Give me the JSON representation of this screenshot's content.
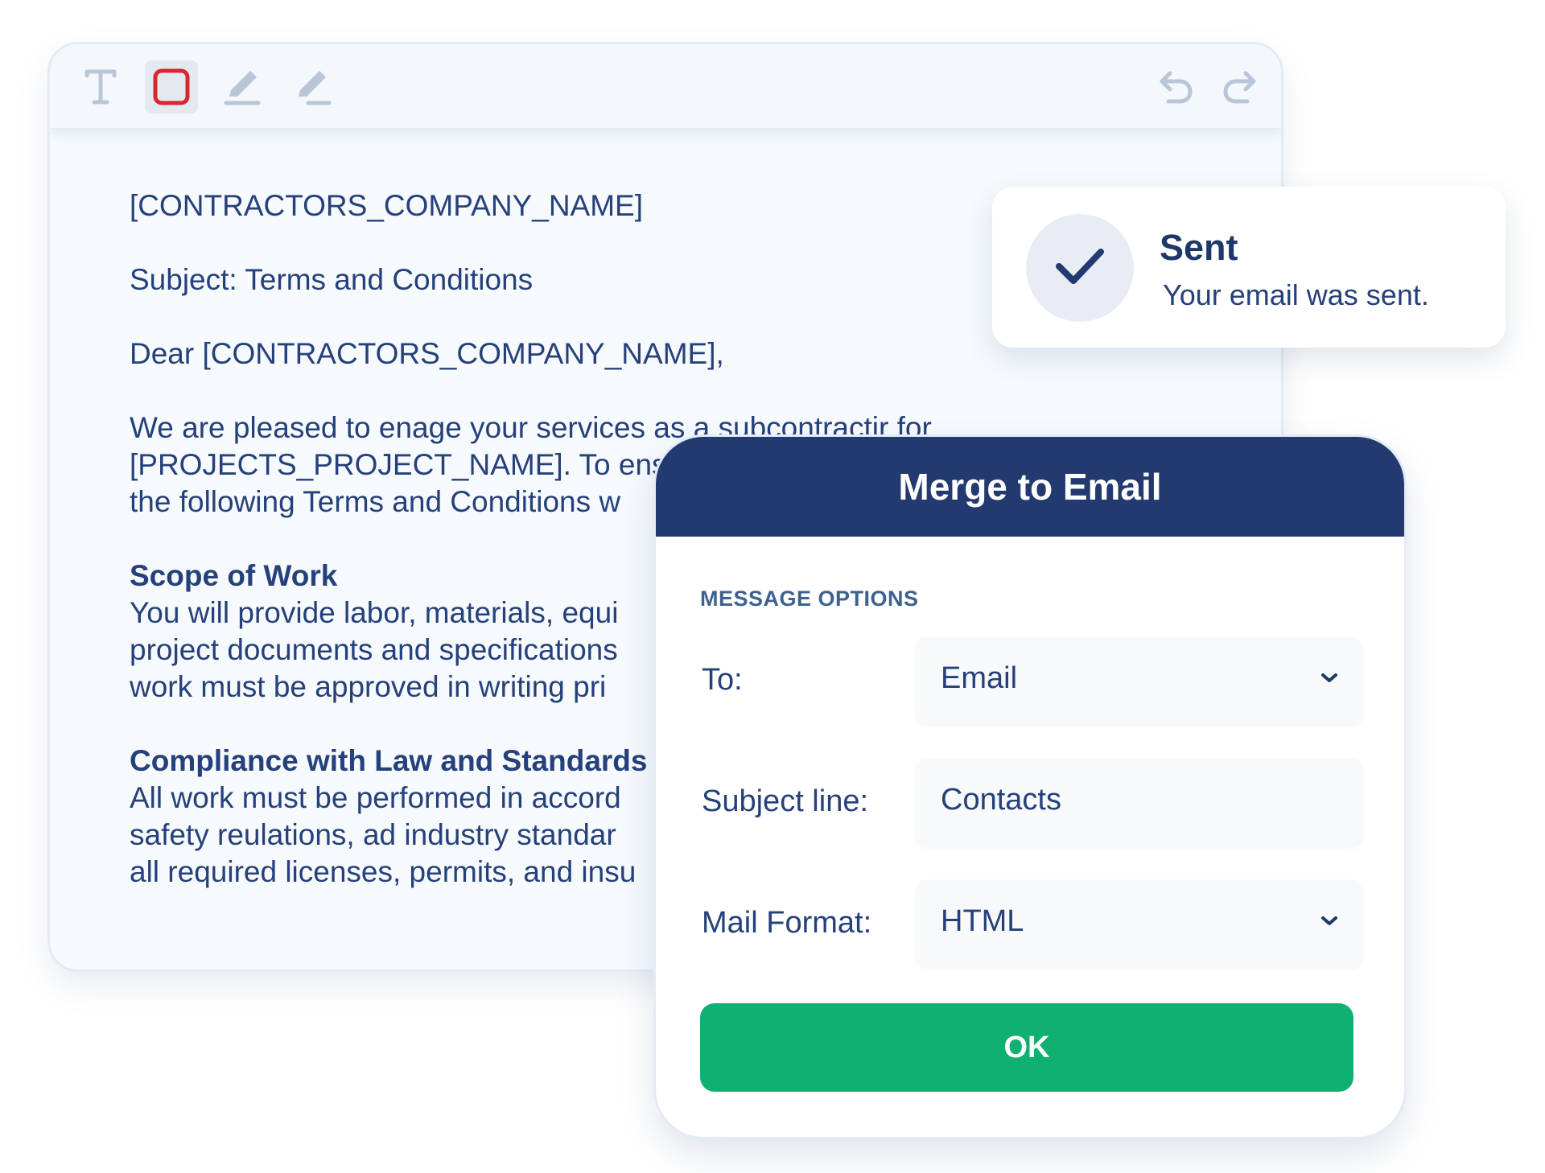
{
  "editor": {
    "toolbar": {
      "tools": [
        {
          "icon": "text-tool-icon"
        },
        {
          "icon": "rectangle-tool-icon",
          "active": true,
          "color": "#d9262f"
        },
        {
          "icon": "pen-tool-icon"
        },
        {
          "icon": "highlighter-tool-icon"
        }
      ],
      "undo_icon": "undo-icon",
      "redo_icon": "redo-icon"
    },
    "document": {
      "company_line": "[CONTRACTORS_COMPANY_NAME]",
      "subject_line": "Subject: Terms and Conditions",
      "greeting": "Dear [CONTRACTORS_COMPANY_NAME],",
      "intro": "We are pleased to enage your services as a subcontractir for\n[PROJECTS_PROJECT_NAME]. To ens\nthe following Terms and Conditions w",
      "scope_heading": "Scope of Work",
      "scope_body": "You will provide labor, materials, equi\nproject documents and specifications\nwork must be approved in writing pri",
      "compliance_heading": "Compliance with Law and Standards",
      "compliance_body": "All work must be performed in accord\nsafety reulations, ad industry standar\nall required licenses, permits, and insu"
    }
  },
  "toast": {
    "icon": "checkmark-icon",
    "title": "Sent",
    "message": "Your email was sent."
  },
  "dialog": {
    "title": "Merge to Email",
    "section_label": "MESSAGE OPTIONS",
    "to": {
      "label": "To:",
      "value": "Email"
    },
    "subject": {
      "label": "Subject line:",
      "value": "Contacts"
    },
    "mail_format": {
      "label": "Mail Format:",
      "value": "HTML"
    },
    "ok_label": "OK"
  },
  "colors": {
    "navy": "#223a70",
    "text": "#25407a",
    "ok_green": "#10b072",
    "section_label": "#3d6290",
    "rect_tool_red": "#d9262f"
  }
}
